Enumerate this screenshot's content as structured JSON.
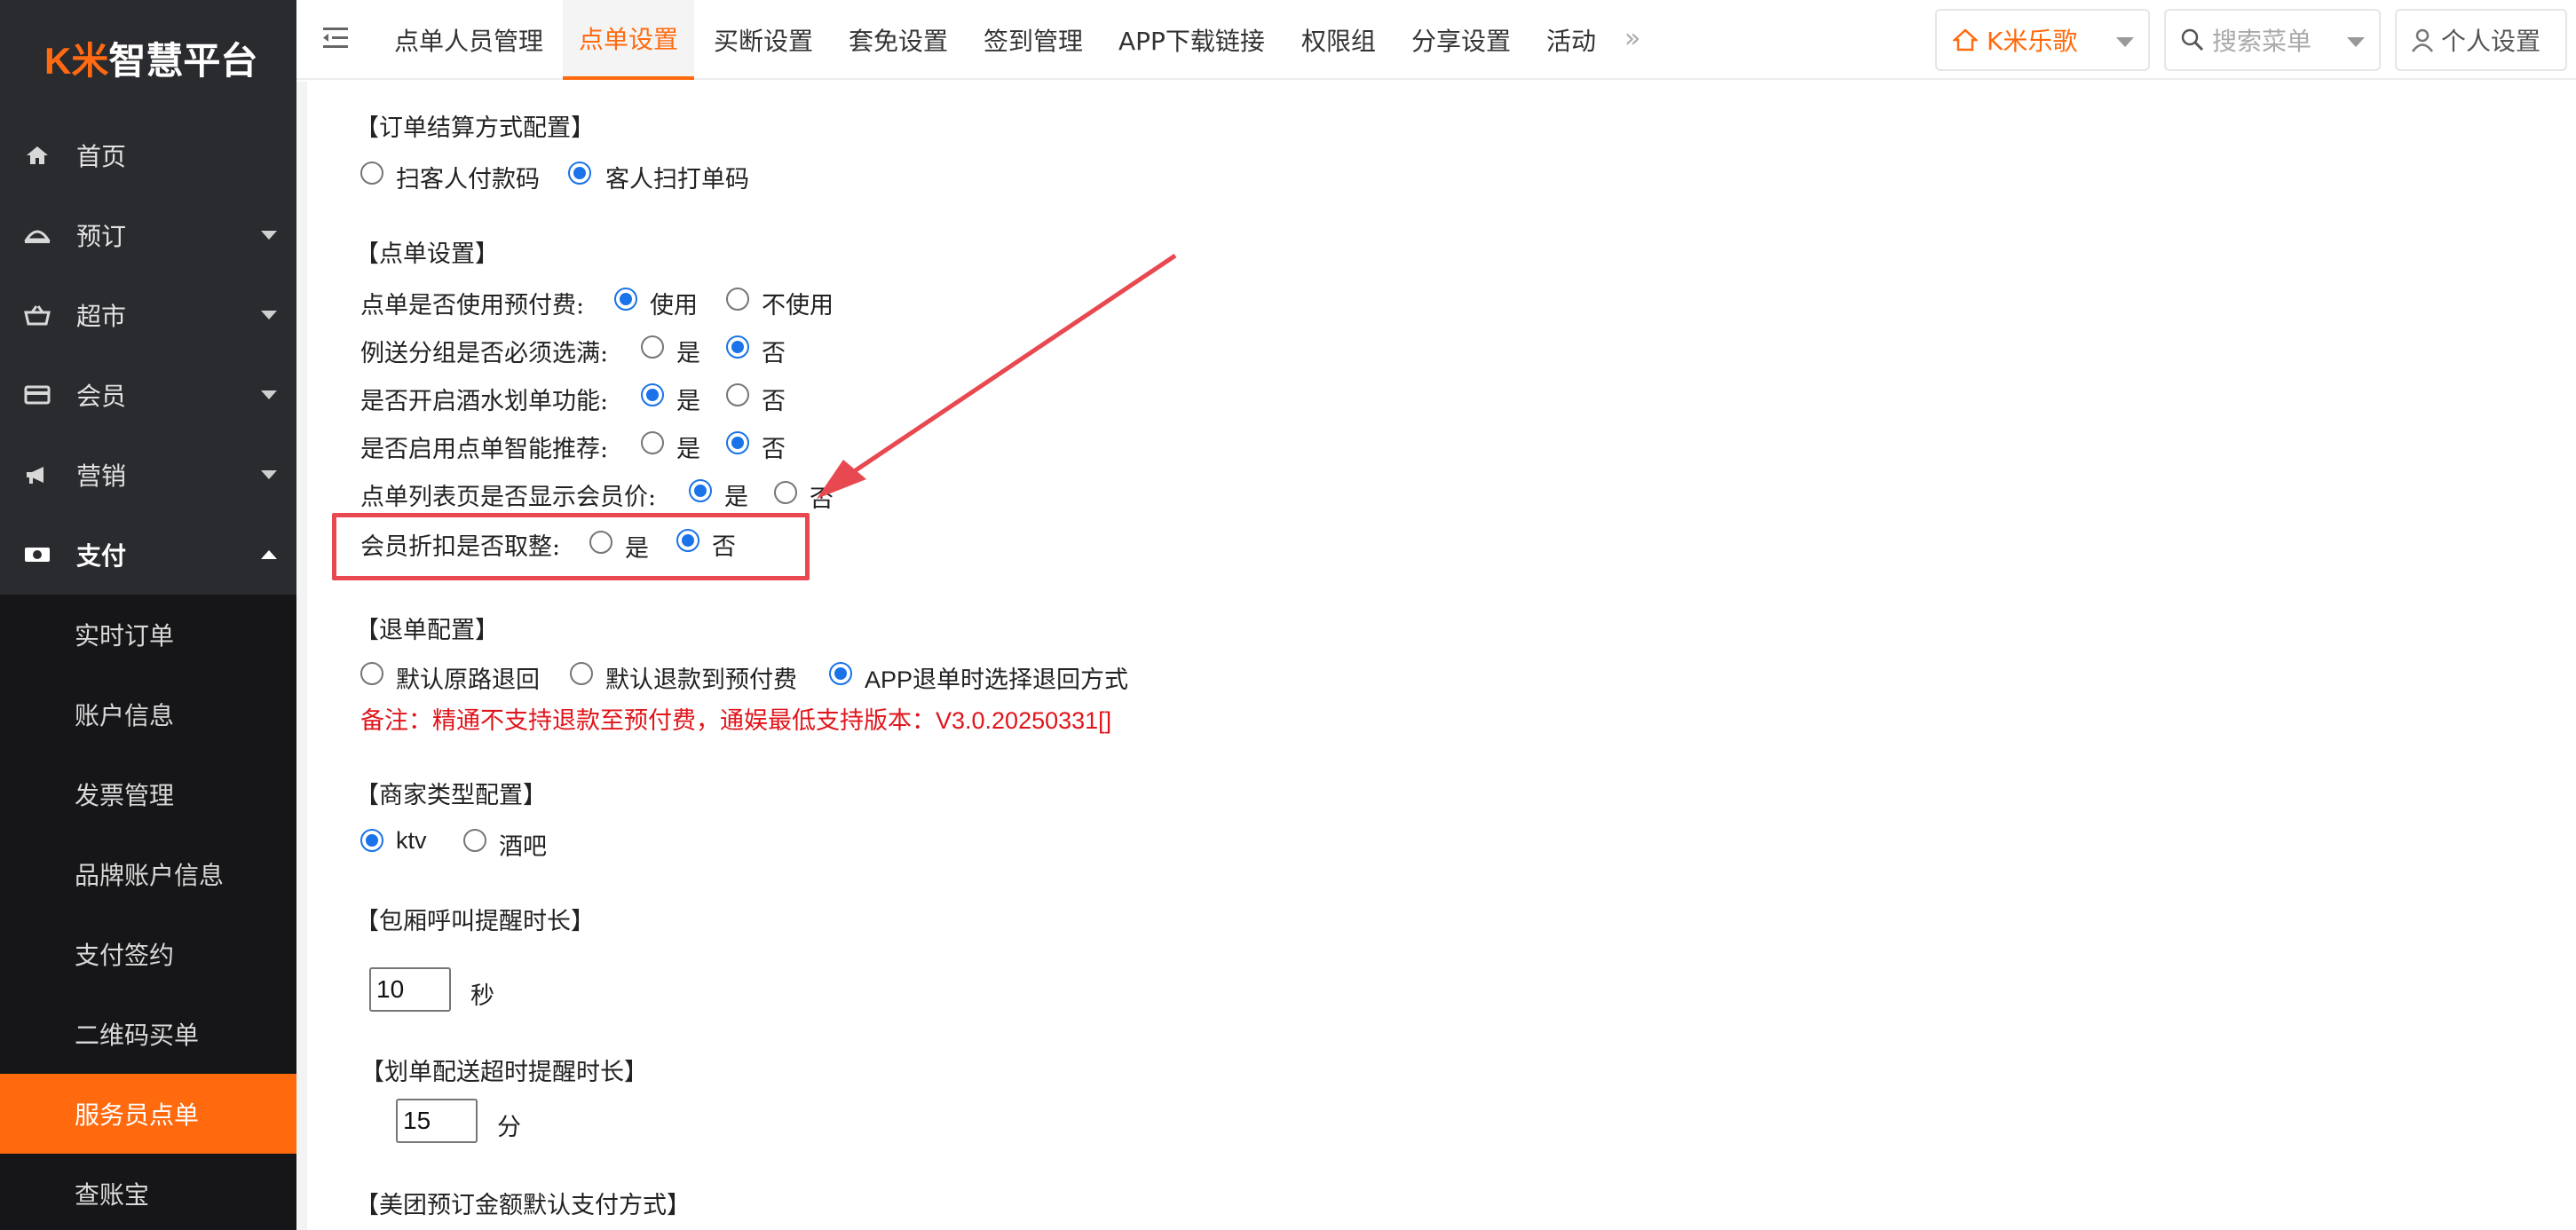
{
  "app": {
    "logo_mark": "K米",
    "logo_text": "智慧平台"
  },
  "sidebar": {
    "items": [
      {
        "label": "首页",
        "icon": "home-icon"
      },
      {
        "label": "预订",
        "icon": "bell-icon"
      },
      {
        "label": "超市",
        "icon": "basket-icon"
      },
      {
        "label": "会员",
        "icon": "card-icon"
      },
      {
        "label": "营销",
        "icon": "megaphone-icon"
      },
      {
        "label": "支付",
        "icon": "money-icon"
      }
    ],
    "submenu": [
      "实时订单",
      "账户信息",
      "发票管理",
      "品牌账户信息",
      "支付签约",
      "二维码买单",
      "服务员点单",
      "查账宝"
    ],
    "active_sub": "服务员点单"
  },
  "topbar": {
    "tabs": [
      "点单人员管理",
      "点单设置",
      "买断设置",
      "套免设置",
      "签到管理",
      "APP下载链接",
      "权限组",
      "分享设置",
      "活动"
    ],
    "active_tab": "点单设置",
    "more": "»",
    "store": "K米乐歌",
    "search_placeholder": "搜索菜单",
    "profile": "个人设置"
  },
  "settings": {
    "settlement": {
      "title": "【订单结算方式配置】",
      "opt1": "扫客人付款码",
      "opt2": "客人扫打单码"
    },
    "order": {
      "title": "【点单设置】",
      "rows": [
        {
          "label": "点单是否使用预付费:",
          "yes": "使用",
          "no": "不使用",
          "value": "yes"
        },
        {
          "label": "例送分组是否必须选满:",
          "yes": "是",
          "no": "否",
          "value": "no"
        },
        {
          "label": "是否开启酒水划单功能:",
          "yes": "是",
          "no": "否",
          "value": "yes"
        },
        {
          "label": "是否启用点单智能推荐:",
          "yes": "是",
          "no": "否",
          "value": "no"
        },
        {
          "label": "点单列表页是否显示会员价:",
          "yes": "是",
          "no": "否",
          "value": "yes"
        },
        {
          "label": "会员折扣是否取整:",
          "yes": "是",
          "no": "否",
          "value": "no"
        }
      ]
    },
    "refund": {
      "title": "【退单配置】",
      "opt1": "默认原路退回",
      "opt2": "默认退款到预付费",
      "opt3": "APP退单时选择退回方式",
      "note": "备注：精通不支持退款至预付费，通娱最低支持版本：V3.0.20250331[]"
    },
    "merchant": {
      "title": "【商家类型配置】",
      "opt1": "ktv",
      "opt2": "酒吧"
    },
    "call": {
      "title": "【包厢呼叫提醒时长】",
      "value": "10",
      "unit": "秒"
    },
    "delivery": {
      "title": "【划单配送超时提醒时长】",
      "value": "15",
      "unit": "分"
    },
    "meituan": {
      "title": "【美团预订金额默认支付方式】"
    }
  },
  "colors": {
    "accent": "#ff6a0f",
    "sidebar_bg": "#2a2b2e",
    "radio": "#1a73e8",
    "highlight": "#e8484f",
    "note": "#e0151b"
  }
}
